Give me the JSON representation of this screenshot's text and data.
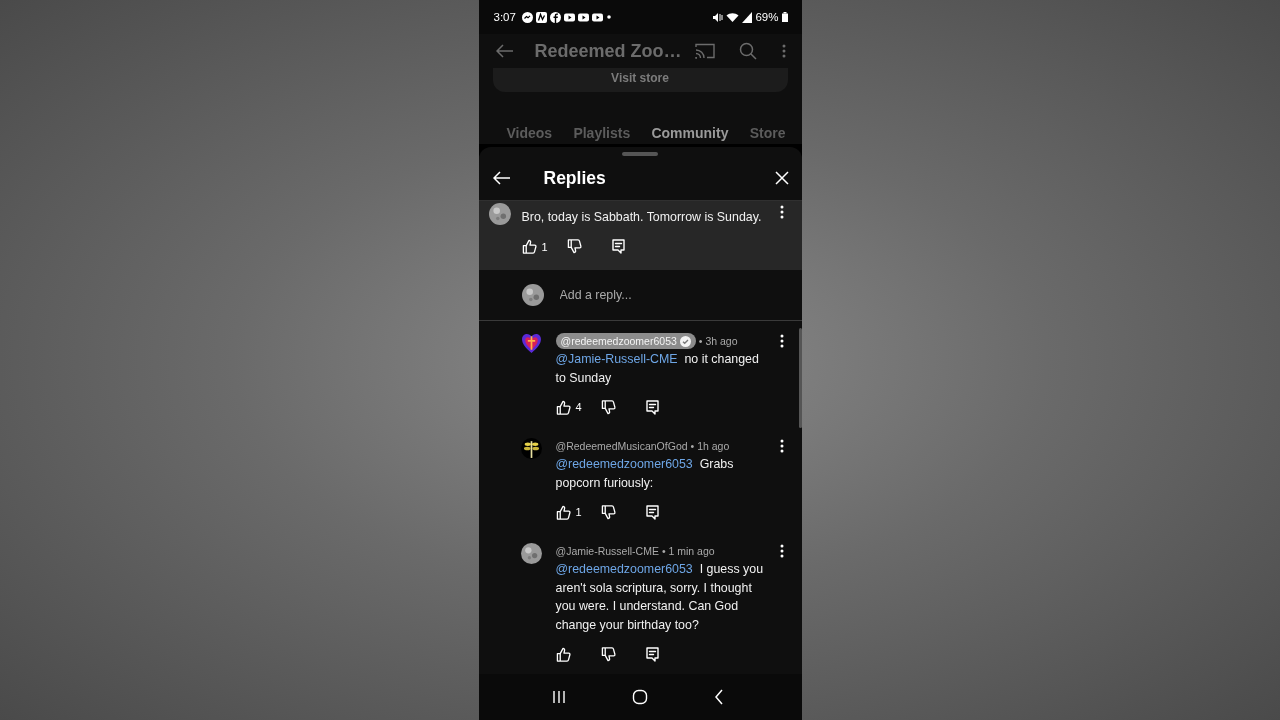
{
  "status_bar": {
    "time": "3:07",
    "battery": "69%"
  },
  "app_bar": {
    "title": "Redeemed Zoo…"
  },
  "visit_store": "Visit store",
  "tabs": [
    {
      "label": "Videos",
      "selected": false
    },
    {
      "label": "Playlists",
      "selected": false
    },
    {
      "label": "Community",
      "selected": true
    },
    {
      "label": "Store",
      "selected": false
    }
  ],
  "sheet": {
    "title": "Replies"
  },
  "parent_comment": {
    "avatar": {
      "kind": "moon"
    },
    "text": "Bro, today is Sabbath.  Tomorrow is Sunday.",
    "likes": "1"
  },
  "reply_box": {
    "avatar": {
      "kind": "moon"
    },
    "placeholder": "Add a reply..."
  },
  "replies": [
    {
      "avatar": {
        "kind": "heart"
      },
      "author": "@redeemedzoomer6053",
      "author_highlighted": true,
      "verified": true,
      "time": "• 3h ago",
      "mention": "@Jamie-Russell-CME",
      "text": "no it changed to Sunday",
      "likes": "4"
    },
    {
      "avatar": {
        "kind": "sprig"
      },
      "author": "@RedeemedMusicanOfGod",
      "author_highlighted": false,
      "verified": false,
      "time": "• 1h ago",
      "mention": "@redeemedzoomer6053",
      "text": "Grabs popcorn furiously:",
      "likes": "1"
    },
    {
      "avatar": {
        "kind": "moon"
      },
      "author": "@Jamie-Russell-CME",
      "author_highlighted": false,
      "verified": false,
      "time": "• 1 min ago",
      "mention": "@redeemedzoomer6053",
      "text": "I guess you aren't sola scriptura, sorry.  I thought you were. I understand.     Can God change your birthday too?"
    }
  ]
}
